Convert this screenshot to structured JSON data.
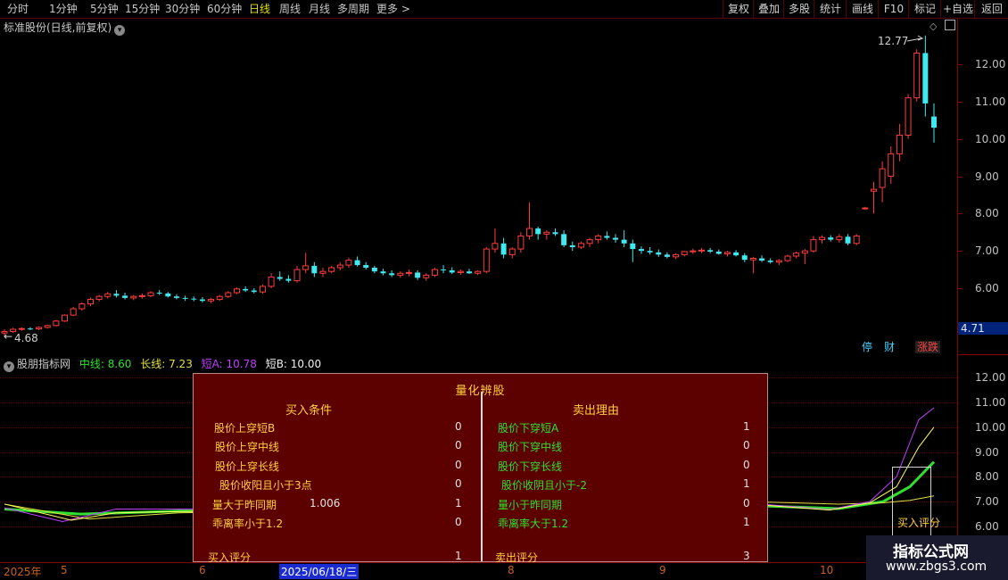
{
  "toolbar": {
    "periods": [
      "分时",
      "1分钟",
      "5分钟",
      "15分钟",
      "30分钟",
      "60分钟",
      "日线",
      "周线",
      "月线",
      "多周期",
      "更多 >"
    ],
    "active_period": "日线",
    "right_buttons": [
      "复权",
      "叠加",
      "多股",
      "统计",
      "画线",
      "F10",
      "标记",
      "+自选",
      "返回"
    ]
  },
  "main_chart": {
    "title": "标准股份(日线,前复权)",
    "high_label": "12.77",
    "low_label": "4.68",
    "last_price": "4.71",
    "y_ticks": [
      "12.00",
      "11.00",
      "10.00",
      "9.00",
      "8.00",
      "7.00",
      "6.00"
    ],
    "badges": [
      "停",
      "财",
      "涨跌"
    ],
    "badge_colors": [
      "#4ad0ff",
      "#4ad0ff",
      "#ff4040"
    ]
  },
  "indicator": {
    "name": "股朋指标网",
    "mid_label": "中线: 8.60",
    "long_label": "长线: 7.23",
    "short_a_label": "短A: 10.78",
    "short_b_label": "短B: 10.00",
    "y_ticks": [
      "12.00",
      "11.00",
      "10.00",
      "9.00",
      "8.00",
      "7.00",
      "6.00"
    ],
    "buy_score_note": "买入评分"
  },
  "panel": {
    "title": "量化辨股",
    "buy_header": "买入条件",
    "sell_header": "卖出理由",
    "buy_rows": [
      {
        "label": "股价上穿短B",
        "extra": "",
        "value": "0"
      },
      {
        "label": "股价上穿中线",
        "extra": "",
        "value": "0"
      },
      {
        "label": "股价上穿长线",
        "extra": "",
        "value": "0"
      },
      {
        "label": "股价收阳且小于3点",
        "extra": "",
        "value": "0"
      },
      {
        "label": "量大于昨同期",
        "extra": "1.006",
        "value": "1"
      },
      {
        "label": "乖离率小于1.2",
        "extra": "",
        "value": "0"
      }
    ],
    "sell_rows": [
      {
        "label": "股价下穿短A",
        "value": "1"
      },
      {
        "label": "股价下穿中线",
        "value": "0"
      },
      {
        "label": "股价下穿长线",
        "value": "0"
      },
      {
        "label": "股价收阴且小于-2",
        "value": "1"
      },
      {
        "label": "量小于昨同期",
        "value": "0"
      },
      {
        "label": "乖离率大于1.2",
        "value": "1"
      }
    ],
    "buy_score_label": "买入评分",
    "buy_score": "1",
    "sell_score_label": "卖出评分",
    "sell_score": "3"
  },
  "date_axis": {
    "labels": [
      "2025年",
      "5",
      "6",
      "8",
      "9",
      "10"
    ],
    "selected": "2025/06/18/三"
  },
  "watermark": {
    "line1": "指标公式网",
    "line2": "www.zbgs3.com"
  },
  "chart_data": {
    "type": "candlestick",
    "y_range": [
      4.5,
      13.0
    ],
    "high": 12.77,
    "low": 4.68,
    "candles": [
      [
        4.8,
        4.9,
        4.72,
        4.84
      ],
      [
        4.84,
        4.94,
        4.8,
        4.9
      ],
      [
        4.9,
        4.95,
        4.86,
        4.92
      ],
      [
        4.92,
        4.96,
        4.88,
        4.91
      ],
      [
        4.91,
        4.98,
        4.88,
        4.95
      ],
      [
        4.95,
        5.02,
        4.92,
        5.0
      ],
      [
        5.0,
        5.15,
        4.98,
        5.12
      ],
      [
        5.12,
        5.3,
        5.1,
        5.28
      ],
      [
        5.28,
        5.5,
        5.25,
        5.45
      ],
      [
        5.45,
        5.62,
        5.4,
        5.58
      ],
      [
        5.58,
        5.75,
        5.52,
        5.7
      ],
      [
        5.7,
        5.82,
        5.65,
        5.78
      ],
      [
        5.78,
        5.9,
        5.72,
        5.85
      ],
      [
        5.85,
        5.95,
        5.75,
        5.8
      ],
      [
        5.8,
        5.88,
        5.7,
        5.74
      ],
      [
        5.74,
        5.82,
        5.68,
        5.78
      ],
      [
        5.78,
        5.86,
        5.72,
        5.8
      ],
      [
        5.8,
        5.92,
        5.76,
        5.88
      ],
      [
        5.88,
        5.95,
        5.82,
        5.86
      ],
      [
        5.86,
        5.9,
        5.75,
        5.78
      ],
      [
        5.78,
        5.84,
        5.7,
        5.74
      ],
      [
        5.74,
        5.8,
        5.66,
        5.72
      ],
      [
        5.72,
        5.78,
        5.65,
        5.7
      ],
      [
        5.7,
        5.76,
        5.62,
        5.66
      ],
      [
        5.66,
        5.74,
        5.6,
        5.7
      ],
      [
        5.7,
        5.82,
        5.66,
        5.78
      ],
      [
        5.78,
        5.92,
        5.74,
        5.88
      ],
      [
        5.88,
        6.02,
        5.84,
        5.98
      ],
      [
        5.98,
        6.05,
        5.9,
        5.94
      ],
      [
        5.94,
        6.0,
        5.86,
        5.9
      ],
      [
        5.9,
        6.1,
        5.85,
        6.05
      ],
      [
        6.05,
        6.4,
        6.0,
        6.3
      ],
      [
        6.3,
        6.45,
        6.2,
        6.25
      ],
      [
        6.25,
        6.35,
        6.15,
        6.2
      ],
      [
        6.2,
        6.6,
        6.15,
        6.5
      ],
      [
        6.5,
        6.95,
        6.4,
        6.6
      ],
      [
        6.6,
        6.7,
        6.3,
        6.4
      ],
      [
        6.4,
        6.55,
        6.3,
        6.45
      ],
      [
        6.45,
        6.6,
        6.4,
        6.55
      ],
      [
        6.55,
        6.7,
        6.48,
        6.62
      ],
      [
        6.62,
        6.82,
        6.55,
        6.75
      ],
      [
        6.75,
        6.85,
        6.58,
        6.62
      ],
      [
        6.62,
        6.7,
        6.5,
        6.55
      ],
      [
        6.55,
        6.6,
        6.4,
        6.45
      ],
      [
        6.45,
        6.52,
        6.35,
        6.4
      ],
      [
        6.4,
        6.48,
        6.3,
        6.35
      ],
      [
        6.35,
        6.45,
        6.28,
        6.4
      ],
      [
        6.4,
        6.5,
        6.32,
        6.42
      ],
      [
        6.42,
        6.48,
        6.22,
        6.28
      ],
      [
        6.28,
        6.4,
        6.2,
        6.35
      ],
      [
        6.35,
        6.55,
        6.3,
        6.5
      ],
      [
        6.5,
        6.62,
        6.4,
        6.48
      ],
      [
        6.48,
        6.56,
        6.38,
        6.42
      ],
      [
        6.42,
        6.5,
        6.36,
        6.45
      ],
      [
        6.45,
        6.52,
        6.38,
        6.4
      ],
      [
        6.4,
        6.48,
        6.35,
        6.45
      ],
      [
        6.45,
        7.1,
        6.4,
        7.05
      ],
      [
        7.05,
        7.6,
        6.95,
        7.2
      ],
      [
        7.2,
        7.35,
        6.8,
        6.9
      ],
      [
        6.9,
        7.1,
        6.8,
        7.05
      ],
      [
        7.05,
        7.5,
        6.95,
        7.4
      ],
      [
        7.4,
        8.3,
        7.3,
        7.6
      ],
      [
        7.6,
        7.65,
        7.3,
        7.45
      ],
      [
        7.45,
        7.55,
        7.3,
        7.5
      ],
      [
        7.5,
        7.6,
        7.4,
        7.45
      ],
      [
        7.45,
        7.55,
        7.1,
        7.15
      ],
      [
        7.15,
        7.25,
        7.0,
        7.1
      ],
      [
        7.1,
        7.25,
        7.05,
        7.2
      ],
      [
        7.2,
        7.35,
        7.1,
        7.3
      ],
      [
        7.3,
        7.45,
        7.2,
        7.4
      ],
      [
        7.4,
        7.52,
        7.3,
        7.35
      ],
      [
        7.35,
        7.45,
        7.22,
        7.3
      ],
      [
        7.3,
        7.55,
        7.1,
        7.2
      ],
      [
        7.2,
        7.3,
        6.7,
        7.05
      ],
      [
        7.05,
        7.12,
        6.92,
        7.0
      ],
      [
        7.0,
        7.1,
        6.9,
        6.96
      ],
      [
        6.96,
        7.04,
        6.84,
        6.9
      ],
      [
        6.9,
        6.96,
        6.8,
        6.84
      ],
      [
        6.84,
        6.94,
        6.78,
        6.9
      ],
      [
        6.9,
        7.0,
        6.85,
        6.98
      ],
      [
        6.98,
        7.06,
        6.92,
        7.0
      ],
      [
        7.0,
        7.08,
        6.94,
        7.02
      ],
      [
        7.02,
        7.08,
        6.94,
        6.98
      ],
      [
        6.98,
        7.04,
        6.9,
        6.92
      ],
      [
        6.92,
        7.0,
        6.85,
        6.96
      ],
      [
        6.96,
        7.02,
        6.85,
        6.88
      ],
      [
        6.88,
        6.94,
        6.7,
        6.76
      ],
      [
        6.76,
        6.84,
        6.4,
        6.8
      ],
      [
        6.8,
        6.88,
        6.7,
        6.74
      ],
      [
        6.74,
        6.8,
        6.66,
        6.7
      ],
      [
        6.7,
        6.78,
        6.62,
        6.74
      ],
      [
        6.74,
        6.9,
        6.7,
        6.86
      ],
      [
        6.86,
        6.98,
        6.8,
        6.94
      ],
      [
        6.94,
        7.05,
        6.65,
        7.0
      ],
      [
        7.0,
        7.4,
        6.95,
        7.3
      ],
      [
        7.3,
        7.42,
        7.2,
        7.36
      ],
      [
        7.36,
        7.42,
        7.25,
        7.3
      ],
      [
        7.3,
        7.45,
        7.22,
        7.38
      ],
      [
        7.38,
        7.45,
        7.15,
        7.2
      ],
      [
        7.2,
        7.45,
        7.15,
        7.4
      ],
      [
        8.15,
        8.18,
        8.1,
        8.15
      ],
      [
        8.6,
        8.85,
        8.0,
        8.65
      ],
      [
        8.7,
        9.4,
        8.3,
        9.2
      ],
      [
        9.0,
        9.8,
        8.8,
        9.6
      ],
      [
        9.6,
        10.4,
        9.4,
        10.1
      ],
      [
        10.1,
        11.2,
        10.0,
        11.1
      ],
      [
        11.1,
        12.4,
        11.0,
        12.3
      ],
      [
        12.3,
        12.77,
        10.6,
        10.95
      ],
      [
        10.6,
        10.95,
        9.9,
        10.3
      ]
    ],
    "indicator_range": [
      5.5,
      12.5
    ],
    "series": [
      {
        "name": "中线",
        "color": "#30e030",
        "start": 7.0,
        "end": 8.6
      },
      {
        "name": "长线",
        "color": "#e0e040",
        "start": 6.9,
        "end": 7.23
      },
      {
        "name": "短A",
        "color": "#c040ff",
        "start": 7.0,
        "end": 10.78
      },
      {
        "name": "短B",
        "color": "#ffff60",
        "start": 6.95,
        "end": 10.0
      }
    ]
  }
}
